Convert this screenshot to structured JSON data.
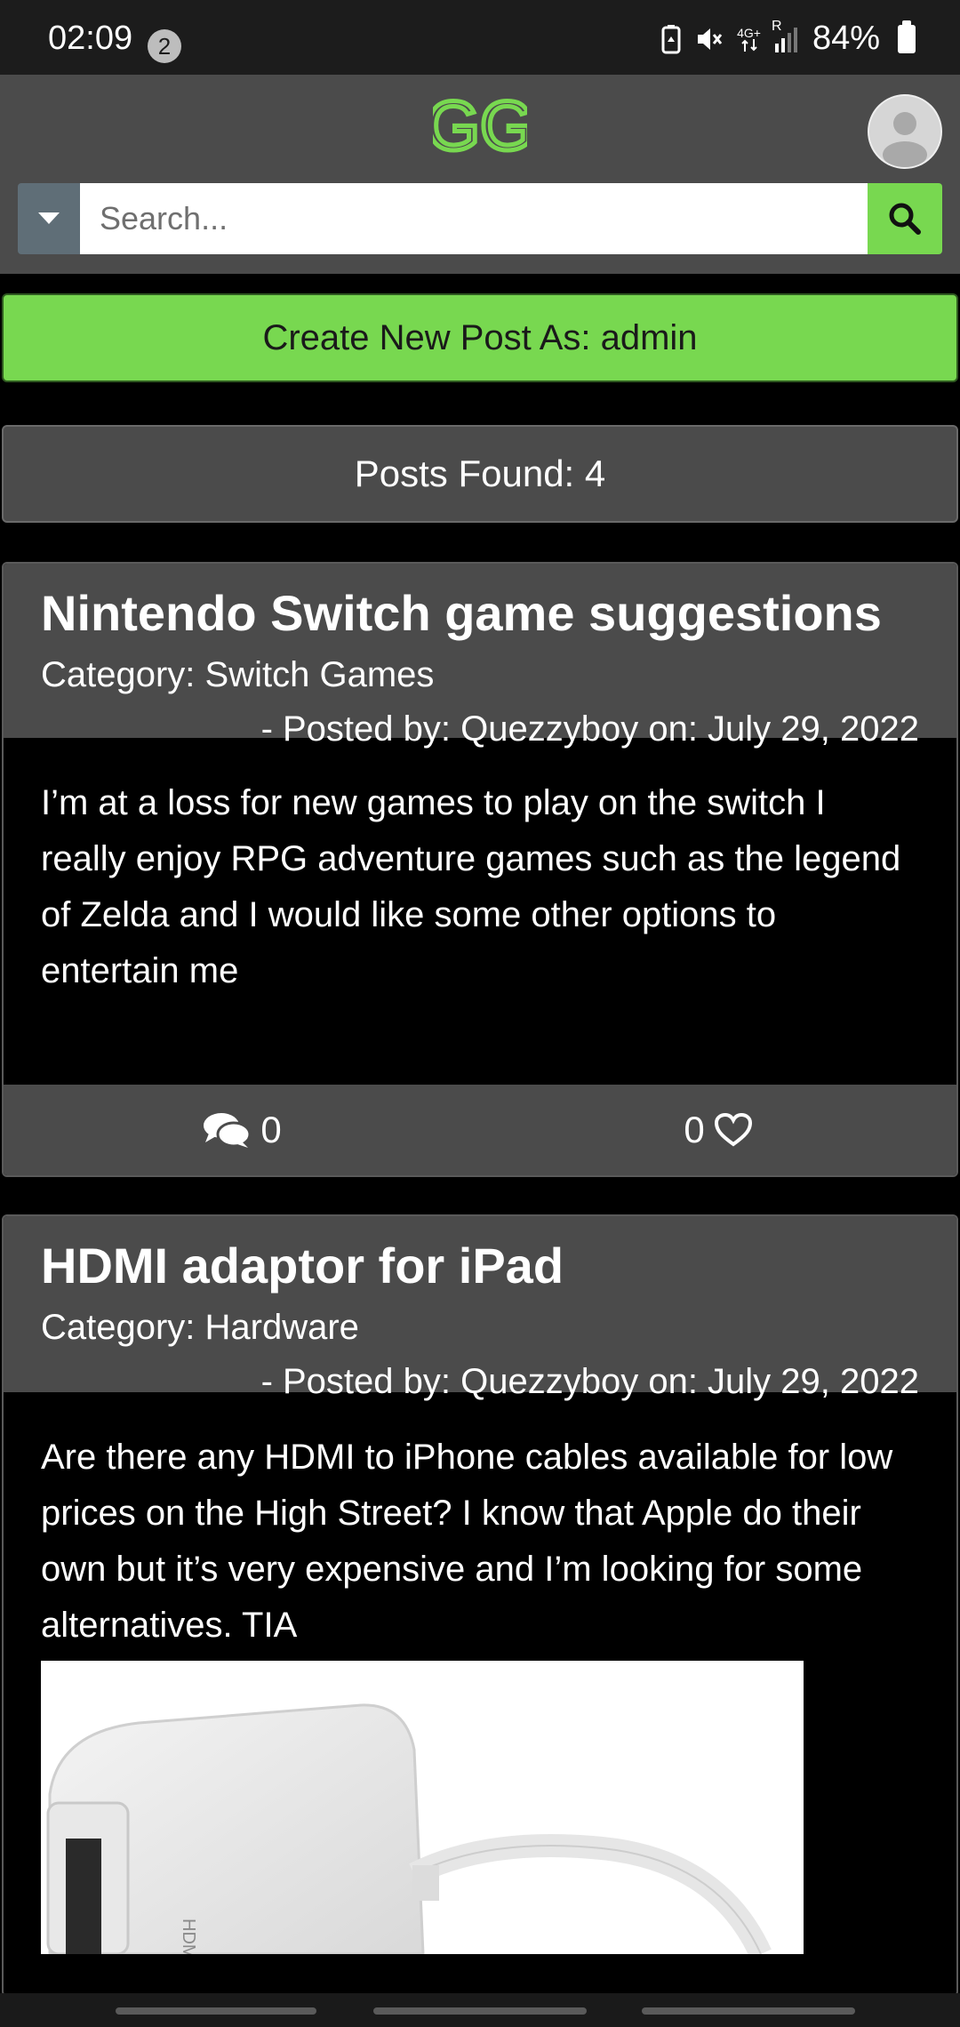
{
  "status_bar": {
    "time": "02:09",
    "notification_count": "2",
    "network_label": "4G+",
    "roaming_label": "R",
    "battery_percent": "84%"
  },
  "header": {
    "logo_text": "GG",
    "search_placeholder": "Search...",
    "brand_color": "#78d850"
  },
  "create_post_label": "Create New Post As: admin",
  "posts_found_label": "Posts Found: 4",
  "posts": [
    {
      "title": "Nintendo Switch game suggestions",
      "category": "Category: Switch Games",
      "meta": "- Posted by: Quezzyboy on: July 29, 2022",
      "body": "I’m at a loss for new games to play on the switch I really enjoy RPG adventure games such as the legend of Zelda and I would like some other options to entertain me",
      "comments": "0",
      "likes": "0"
    },
    {
      "title": "HDMI adaptor for iPad",
      "category": "Category: Hardware",
      "meta": "- Posted by: Quezzyboy on: July 29, 2022",
      "body": "Are there any HDMI to iPhone cables available for low prices on the High Street? I know that Apple do their own but it’s very expensive and I’m looking for some alternatives. TIA",
      "image_caption": "HDMI"
    }
  ]
}
